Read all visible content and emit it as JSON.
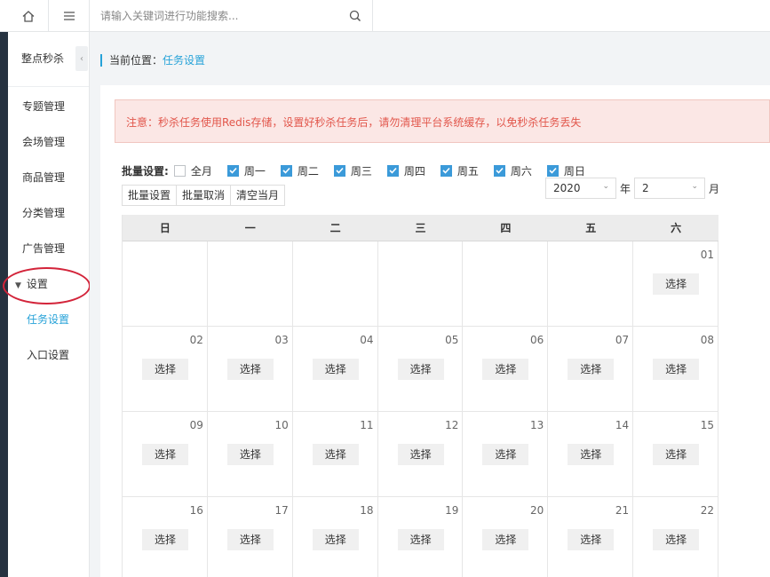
{
  "search": {
    "placeholder": "请输入关键词进行功能搜索..."
  },
  "sidebar": {
    "title": "整点秒杀",
    "items": [
      {
        "label": "专题管理"
      },
      {
        "label": "会场管理"
      },
      {
        "label": "商品管理"
      },
      {
        "label": "分类管理"
      },
      {
        "label": "广告管理"
      }
    ],
    "group": {
      "label": "设置",
      "children": [
        {
          "label": "任务设置",
          "active": true
        },
        {
          "label": "入口设置"
        }
      ]
    }
  },
  "breadcrumb": {
    "prefix": "当前位置：",
    "current": "任务设置"
  },
  "notice": "注意：秒杀任务使用Redis存储，设置好秒杀任务后，请勿清理平台系统缓存，以免秒杀任务丢失",
  "batch": {
    "label": "批量设置:",
    "options": [
      {
        "label": "全月",
        "checked": false
      },
      {
        "label": "周一",
        "checked": true
      },
      {
        "label": "周二",
        "checked": true
      },
      {
        "label": "周三",
        "checked": true
      },
      {
        "label": "周四",
        "checked": true
      },
      {
        "label": "周五",
        "checked": true
      },
      {
        "label": "周六",
        "checked": true
      },
      {
        "label": "周日",
        "checked": true
      }
    ],
    "buttons": [
      "批量设置",
      "批量取消",
      "清空当月"
    ]
  },
  "date": {
    "year": "2020",
    "year_unit": "年",
    "month": "2",
    "month_unit": "月"
  },
  "calendar": {
    "weekdays": [
      "日",
      "一",
      "二",
      "三",
      "四",
      "五",
      "六"
    ],
    "pick_label": "选择",
    "weeks": [
      [
        "",
        "",
        "",
        "",
        "",
        "",
        "01"
      ],
      [
        "02",
        "03",
        "04",
        "05",
        "06",
        "07",
        "08"
      ],
      [
        "09",
        "10",
        "11",
        "12",
        "13",
        "14",
        "15"
      ],
      [
        "16",
        "17",
        "18",
        "19",
        "20",
        "21",
        "22"
      ]
    ]
  },
  "colors": {
    "accent": "#26a2d8",
    "notice_text": "#e2564b",
    "notice_bg": "#fbe7e5",
    "highlight": "#d3243a"
  }
}
